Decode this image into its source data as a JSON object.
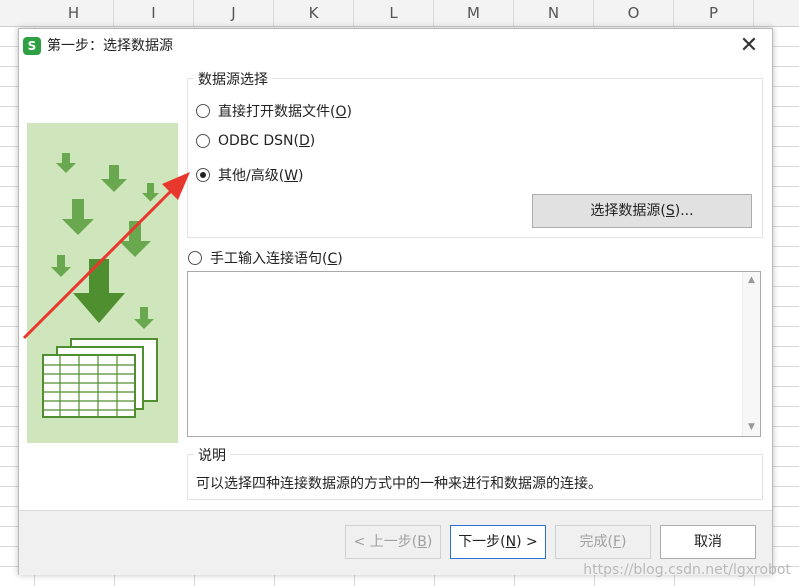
{
  "sheet": {
    "columns": [
      "H",
      "I",
      "J",
      "K",
      "L",
      "M",
      "N",
      "O",
      "P"
    ]
  },
  "dialog": {
    "title": "第一步：选择数据源",
    "close_icon": "close-icon",
    "app_icon_letter": "S",
    "datasource_group": {
      "title": "数据源选择",
      "options": [
        {
          "label": "直接打开数据文件(",
          "key": "O",
          "suffix": ")",
          "selected": false
        },
        {
          "label": "ODBC DSN(",
          "key": "D",
          "suffix": ")",
          "selected": false
        },
        {
          "label": "其他/高级(",
          "key": "W",
          "suffix": ")",
          "selected": true
        }
      ],
      "select_button": {
        "label": "选择数据源(",
        "key": "S",
        "suffix": ")..."
      }
    },
    "manual": {
      "label": "手工输入连接语句(",
      "key": "C",
      "suffix": ")",
      "selected": false,
      "text": ""
    },
    "description": {
      "title": "说明",
      "text": "可以选择四种连接数据源的方式中的一种来进行和数据源的连接。"
    },
    "footer": {
      "prev": {
        "label": "< 上一步(",
        "key": "B",
        "suffix": ")",
        "disabled": true
      },
      "next": {
        "label": "下一步(",
        "key": "N",
        "suffix": ") >",
        "disabled": false
      },
      "finish": {
        "label": "完成(",
        "key": "F",
        "suffix": ")",
        "disabled": true
      },
      "cancel": {
        "label": "取消"
      }
    }
  },
  "watermark": "https://blog.csdn.net/lgxrobot",
  "colors": {
    "art_background": "#cfe6bc",
    "art_green": "#5a9e3a",
    "annotation_arrow": "#e8382d",
    "primary_border": "#2b6fd6"
  }
}
